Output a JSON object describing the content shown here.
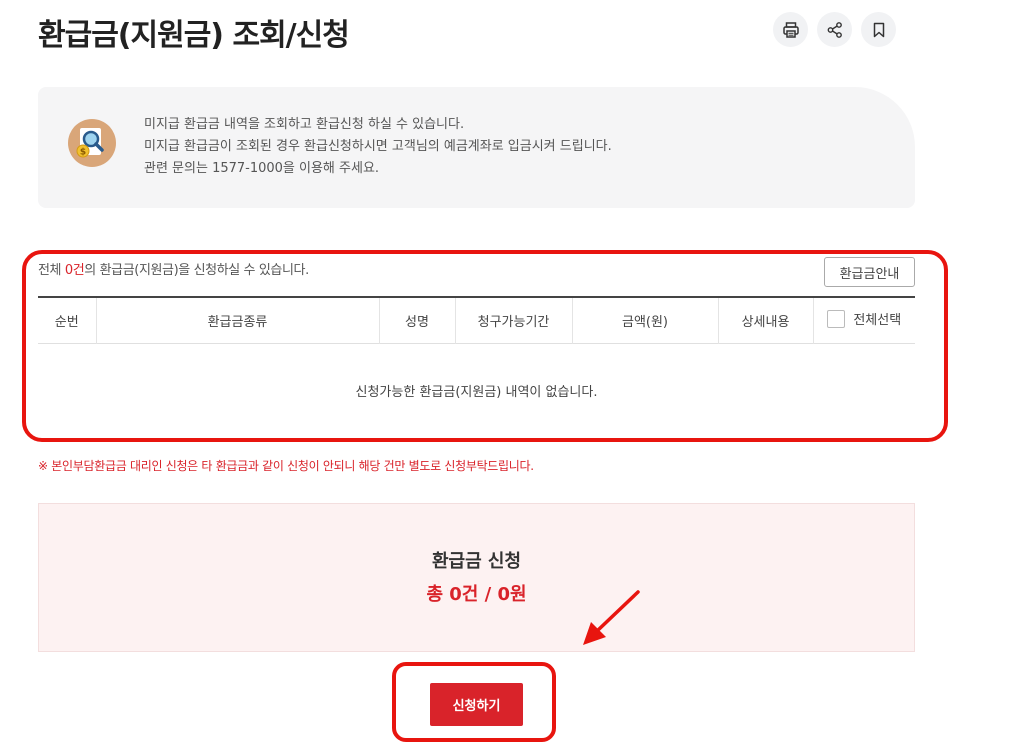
{
  "page": {
    "title": "환급금(지원금) 조회/신청"
  },
  "toolbar": {
    "icons": [
      "print-icon",
      "share-icon",
      "bookmark-icon"
    ]
  },
  "info_box": {
    "lines": [
      "미지급 환급금 내역을 조회하고 환급신청 하실 수 있습니다.",
      "미지급 환급금이 조회된 경우 환급신청하시면 고객님의 예금계좌로 입금시켜 드립니다.",
      "관련 문의는 1577-1000을 이용해 주세요."
    ]
  },
  "summary": {
    "prefix": "전체 ",
    "count": "0건",
    "suffix": "의 환급금(지원금)을 신청하실 수 있습니다.",
    "guide_button": "환급금안내"
  },
  "table": {
    "headers": [
      "순번",
      "환급금종류",
      "성명",
      "청구가능기간",
      "금액(원)",
      "상세내용"
    ],
    "select_all_label": "전체선택",
    "empty_message": "신청가능한 환급금(지원금) 내역이 없습니다."
  },
  "notice": "※ 본인부담환급금 대리인 신청은 타 환급금과 같이 신청이 안되니 해당 건만 별도로 신청부탁드립니다.",
  "apply": {
    "title": "환급금 신청",
    "total": "총 0건 / 0원",
    "submit_label": "신청하기"
  },
  "colors": {
    "accent_red": "#d9232a",
    "annotation_red": "#e8150f",
    "panel_pink": "#fdf2f2",
    "info_gray": "#f5f5f6"
  }
}
